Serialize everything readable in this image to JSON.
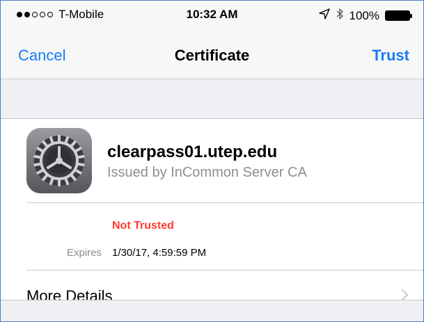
{
  "status_bar": {
    "carrier": "T-Mobile",
    "signal_filled": 2,
    "signal_total": 5,
    "time": "10:32 AM",
    "battery": "100%",
    "icons": [
      "location-arrow-icon",
      "bluetooth-icon",
      "battery-icon"
    ]
  },
  "nav": {
    "cancel": "Cancel",
    "title": "Certificate",
    "trust": "Trust"
  },
  "certificate": {
    "icon": "settings-gear-icon",
    "name": "clearpass01.utep.edu",
    "issuer": "Issued by InCommon Server CA",
    "trust_status": "Not Trusted",
    "expires_label": "Expires",
    "expires_value": "1/30/17, 4:59:59 PM"
  },
  "more_details": {
    "label": "More Details"
  },
  "colors": {
    "accent": "#1a7cf5",
    "warning": "#ff3b30",
    "secondary_text": "#8e8e93",
    "group_background": "#efeff4"
  }
}
